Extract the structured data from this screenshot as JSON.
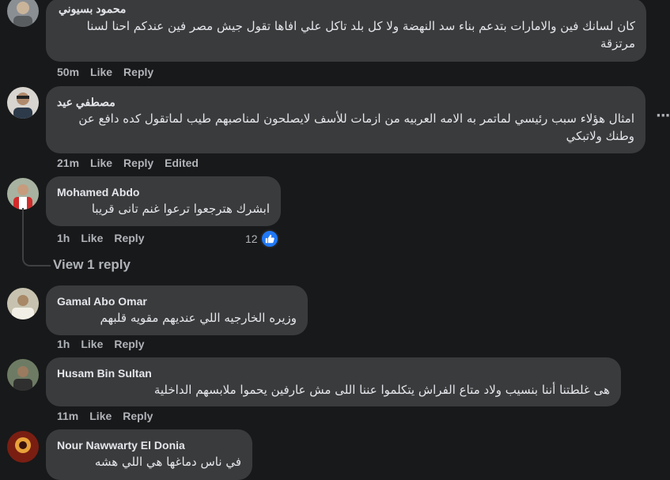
{
  "colors": {
    "background": "#18191a",
    "bubble": "#3a3b3c",
    "text": "#e4e6eb",
    "secondary": "#b0b3b8",
    "like_blue": "#2078f4"
  },
  "comments": [
    {
      "author": "محمود بسيوني",
      "text": "كان لسانك فين والامارات بتدعم بناء سد النهضة ولا كل بلد تاكل علي افاها تقول جيش مصر فين عندكم احنا لسنا مرتزقة",
      "time": "50m",
      "like": "Like",
      "reply": "Reply"
    },
    {
      "author": "مصطفي عيد",
      "text": "امثال هؤلاء سبب رئيسي لماتمر به الامه العربيه من ازمات للأسف لايصلحون لمناصبهم طيب لماتقول كده دافع عن وطنك ولاتبكي",
      "time": "21m",
      "like": "Like",
      "reply": "Reply",
      "edited": "Edited",
      "more_icon": "more-horizontal-icon"
    },
    {
      "author": "Mohamed Abdo",
      "text": "ابشرك هترجعوا ترعوا غنم تانى قريبا",
      "time": "1h",
      "like": "Like",
      "reply": "Reply",
      "reaction_count": "12",
      "reaction_icon": "thumbs-up-icon",
      "view_replies": "View 1 reply"
    },
    {
      "author": "Gamal Abo Omar",
      "text": "وزيره الخارجيه اللي عنديهم مقويه قلبهم",
      "time": "1h",
      "like": "Like",
      "reply": "Reply"
    },
    {
      "author": "Husam Bin Sultan",
      "text": "هى غلطتنا أننا بنسيب ولاد متاع الفراش يتكلموا عننا اللى مش عارفين يحموا ملابسهم الداخلية",
      "time": "11m",
      "like": "Like",
      "reply": "Reply"
    },
    {
      "author": "Nour Nawwarty El Donia",
      "text": "في ناس دماغها هي اللي هشه"
    }
  ]
}
